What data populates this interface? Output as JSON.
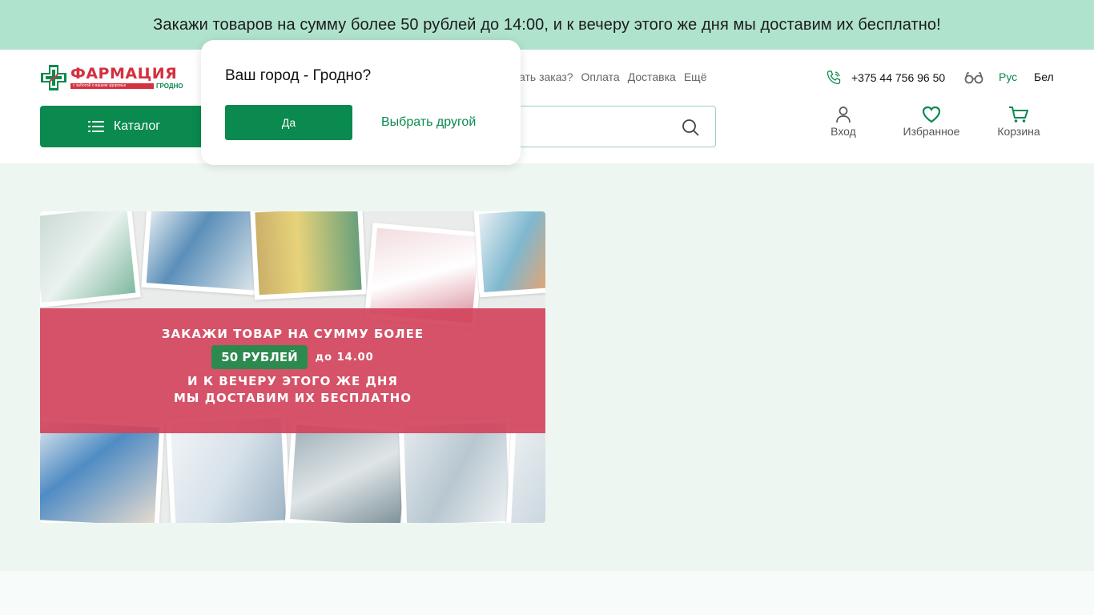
{
  "topbar": {
    "text": "Закажи товаров на сумму более 50 рублей до 14:00, и к вечеру этого же дня мы доставим их бесплатно!"
  },
  "header": {
    "logo": {
      "name": "ФАРМАЦИЯ",
      "tagline": "с заботой о вашем здоровье",
      "city": "ГРОДНО"
    },
    "nav_links": [
      "ать заказ?",
      "Оплата",
      "Доставка",
      "Ещё"
    ],
    "phone": "+375 44 756 96 50",
    "lang_ru": "Рус",
    "lang_by": "Бел",
    "catalog_label": "Каталог",
    "search_placeholder": "",
    "actions": {
      "login": "Вход",
      "favorites": "Избранное",
      "cart": "Корзина"
    }
  },
  "city_popup": {
    "title": "Ваш город - Гродно?",
    "yes_label": "Да",
    "other_label": "Выбрать другой"
  },
  "banner": {
    "line1": "ЗАКАЖИ ТОВАР НА СУММУ БОЛЕЕ",
    "badge": "50 РУБЛЕЙ",
    "time": "до 14.00",
    "line3": "И К ВЕЧЕРУ ЭТОГО ЖЕ ДНЯ",
    "line4": "МЫ ДОСТАВИМ ИХ БЕСПЛАТНО"
  },
  "colors": {
    "brand_green": "#0a8a4e",
    "topbar_bg": "#b0e3cd",
    "brand_red": "#d4303f",
    "banner_band": "#d2445c"
  }
}
